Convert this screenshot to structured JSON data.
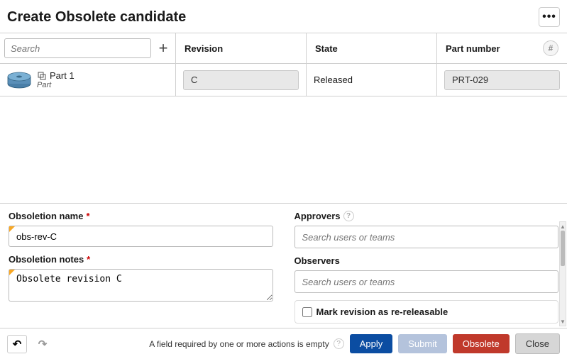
{
  "title": "Create Obsolete candidate",
  "search": {
    "placeholder": "Search"
  },
  "columns": {
    "revision": "Revision",
    "state": "State",
    "part_number": "Part number"
  },
  "item": {
    "name": "Part 1",
    "type": "Part",
    "revision": "C",
    "state": "Released",
    "part_number": "PRT-029"
  },
  "form": {
    "obsoletion_name_label": "Obsoletion name",
    "obsoletion_name": "obs-rev-C",
    "obsoletion_notes_label": "Obsoletion notes",
    "obsoletion_notes": "Obsolete revision C",
    "approvers_label": "Approvers",
    "approvers_placeholder": "Search users or teams",
    "observers_label": "Observers",
    "observers_placeholder": "Search users or teams",
    "re_releasable_label": "Mark revision as re-releasable"
  },
  "footer": {
    "message": "A field required by one or more actions is empty",
    "apply": "Apply",
    "submit": "Submit",
    "obsolete": "Obsolete",
    "close": "Close"
  }
}
